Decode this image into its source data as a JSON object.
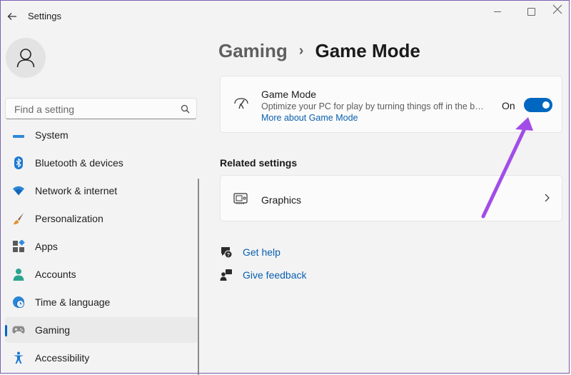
{
  "window": {
    "title": "Settings"
  },
  "search": {
    "placeholder": "Find a setting"
  },
  "sidebar": {
    "items": [
      {
        "label": "System",
        "icon": "system-icon"
      },
      {
        "label": "Bluetooth & devices",
        "icon": "bluetooth-icon"
      },
      {
        "label": "Network & internet",
        "icon": "wifi-icon"
      },
      {
        "label": "Personalization",
        "icon": "brush-icon"
      },
      {
        "label": "Apps",
        "icon": "apps-icon"
      },
      {
        "label": "Accounts",
        "icon": "person-icon"
      },
      {
        "label": "Time & language",
        "icon": "globe-clock-icon"
      },
      {
        "label": "Gaming",
        "icon": "gamepad-icon",
        "active": true
      },
      {
        "label": "Accessibility",
        "icon": "accessibility-icon"
      }
    ]
  },
  "breadcrumb": {
    "parent": "Gaming",
    "separator": "›",
    "current": "Game Mode"
  },
  "game_mode": {
    "title": "Game Mode",
    "description": "Optimize your PC for play by turning things off in the background",
    "link": "More about Game Mode",
    "toggle_label": "On",
    "toggle_on": true
  },
  "related": {
    "heading": "Related settings",
    "items": [
      {
        "label": "Graphics",
        "icon": "graphics-card-icon"
      }
    ]
  },
  "help": {
    "get_help": "Get help",
    "give_feedback": "Give feedback"
  },
  "colors": {
    "accent": "#0067c0",
    "annotation_arrow": "#a24de8"
  }
}
